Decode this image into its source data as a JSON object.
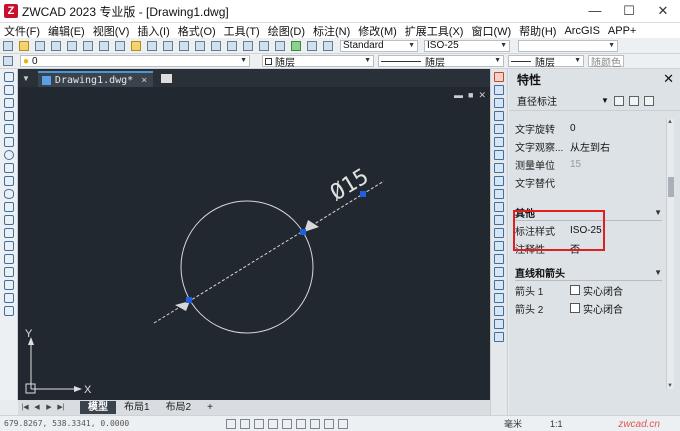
{
  "window": {
    "title": "ZWCAD 2023 专业版 - [Drawing1.dwg]",
    "logo_letter": "Z",
    "minimize": "—",
    "maximize": "☐",
    "close": "✕"
  },
  "menu": [
    "文件(F)",
    "编辑(E)",
    "视图(V)",
    "插入(I)",
    "格式(O)",
    "工具(T)",
    "绘图(D)",
    "标注(N)",
    "修改(M)",
    "扩展工具(X)",
    "窗口(W)",
    "帮助(H)",
    "ArcGIS",
    "APP+"
  ],
  "toolbar": {
    "text_style": "Standard",
    "dim_style": "ISO-25",
    "layer_value": "0",
    "color_value": "随层",
    "linetype_value": "随层",
    "lineweight_value": "随层",
    "plotstyle_value": "随颜色"
  },
  "document": {
    "tab_label": "Drawing1.dwg*",
    "tab_close": "×",
    "view_buttons": [
      "▬",
      "■",
      "✕"
    ]
  },
  "drawing": {
    "dimension_text": "Ø15",
    "ucs_x": "X",
    "ucs_y": "Y"
  },
  "layout_tabs": {
    "nav": [
      "|◀",
      "◀",
      "▶",
      "▶|"
    ],
    "tabs": [
      "模型",
      "布局1",
      "布局2",
      "+"
    ],
    "active": "模型"
  },
  "status": {
    "coords": "679.8267, 538.3341, 0.0000",
    "unit": "毫米",
    "scale": "1:1",
    "watermark": "zwcad.cn"
  },
  "properties": {
    "title": "特性",
    "close": "✕",
    "selection": "直径标注",
    "text_section": [
      {
        "key": "文字旋转",
        "value": "0",
        "dim": false
      },
      {
        "key": "文字观察...",
        "value": "从左到右",
        "dim": false
      },
      {
        "key": "测量单位",
        "value": "15",
        "dim": true
      },
      {
        "key": "文字替代",
        "value": "",
        "dim": false
      }
    ],
    "misc_section": {
      "label": "其他",
      "rows": [
        {
          "key": "标注样式",
          "value": "ISO-25"
        },
        {
          "key": "注释性",
          "value": "否"
        }
      ]
    },
    "lines_section": {
      "label": "直线和箭头",
      "rows": [
        {
          "key": "箭头 1",
          "value": "实心闭合"
        },
        {
          "key": "箭头 2",
          "value": "实心闭合"
        }
      ]
    }
  },
  "colors": {
    "canvas": "#212830",
    "highlight": "#e02020",
    "grip": "#1f5fe0"
  }
}
